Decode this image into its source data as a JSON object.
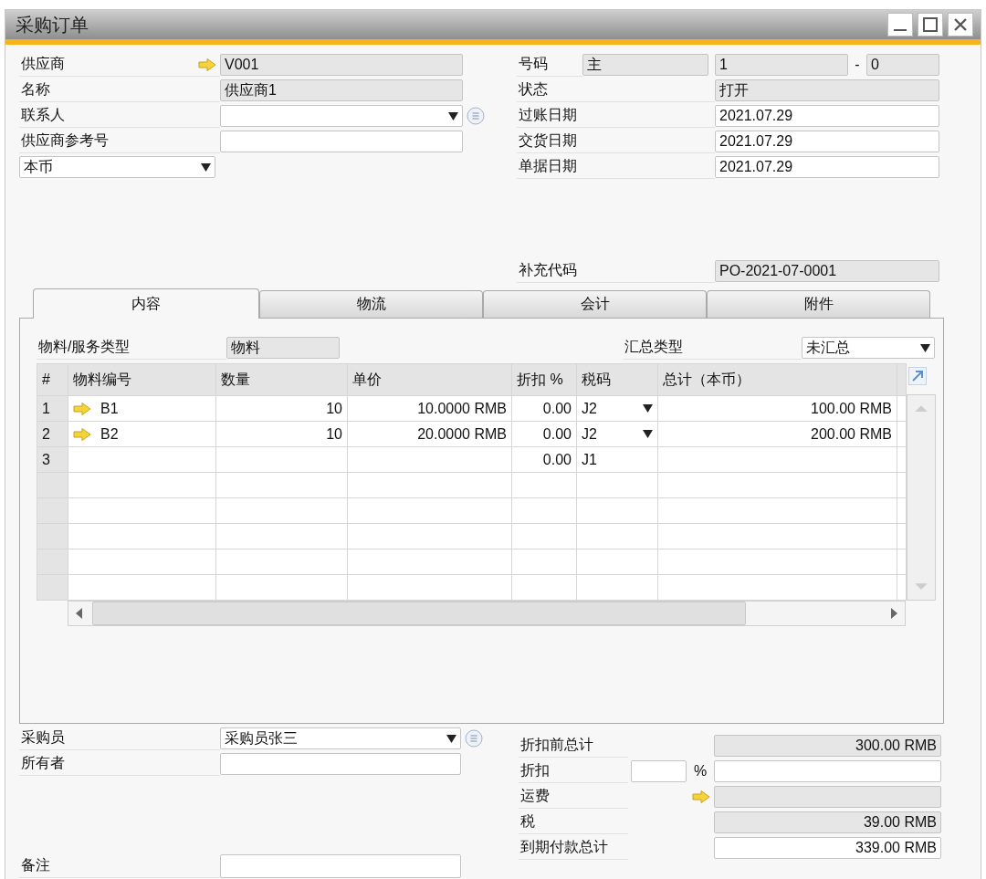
{
  "window": {
    "title": "采购订单"
  },
  "header_left": [
    {
      "label": "供应商",
      "value": "V001",
      "kind": "link",
      "readonly": true
    },
    {
      "label": "名称",
      "value": "供应商1",
      "kind": "text",
      "readonly": true
    },
    {
      "label": "联系人",
      "kind": "dropdown",
      "readonly": false
    },
    {
      "label": "供应商参考号",
      "kind": "text",
      "readonly": false
    }
  ],
  "currency": {
    "value": "本币"
  },
  "header_right": {
    "number": {
      "label": "号码",
      "series": "主",
      "value": "1",
      "separator": "-",
      "suffix": "0"
    },
    "fields": [
      {
        "label": "状态",
        "value": "打开",
        "readonly": true
      },
      {
        "label": "过账日期",
        "value": "2021.07.29",
        "readonly": false
      },
      {
        "label": "交货日期",
        "value": "2021.07.29",
        "readonly": false
      },
      {
        "label": "单据日期",
        "value": "2021.07.29",
        "readonly": false
      }
    ],
    "supplement": {
      "label": "补充代码",
      "value": "PO-2021-07-0001",
      "readonly": true
    }
  },
  "tabs": [
    {
      "label": "内容",
      "selected": true
    },
    {
      "label": "物流",
      "selected": false
    },
    {
      "label": "会计",
      "selected": false
    },
    {
      "label": "附件",
      "selected": false
    }
  ],
  "item_type": {
    "label": "物料/服务类型",
    "value": "物料"
  },
  "summary_type": {
    "label": "汇总类型",
    "value": "未汇总"
  },
  "table": {
    "columns": [
      "#",
      "物料编号",
      "数量",
      "单价",
      "折扣 %",
      "税码",
      "总计（本币）"
    ],
    "rows": [
      {
        "num": "1",
        "item": "B1",
        "link": true,
        "qty": "10",
        "price": "10.0000 RMB",
        "discount": "0.00",
        "tax_code": "J2",
        "tax_dropdown": true,
        "total": "100.00 RMB"
      },
      {
        "num": "2",
        "item": "B2",
        "link": true,
        "qty": "10",
        "price": "20.0000 RMB",
        "discount": "0.00",
        "tax_code": "J2",
        "tax_dropdown": true,
        "total": "200.00 RMB"
      },
      {
        "num": "3",
        "link": false,
        "discount": "0.00",
        "tax_code": "J1",
        "tax_dropdown": false
      }
    ]
  },
  "footer_left": [
    {
      "label": "采购员",
      "value": "采购员张三",
      "kind": "dropdown"
    },
    {
      "label": "所有者",
      "kind": "text"
    }
  ],
  "remarks": {
    "label": "备注"
  },
  "footer_right": [
    {
      "label": "折扣前总计",
      "value": "300.00 RMB",
      "kind": "text",
      "readonly": true
    },
    {
      "label": "折扣",
      "kind": "percent",
      "unit": "%",
      "readonly": false
    },
    {
      "label": "运费",
      "kind": "link",
      "readonly": true
    },
    {
      "label": "税",
      "value": "39.00 RMB",
      "kind": "text",
      "readonly": true
    },
    {
      "label": "到期付款总计",
      "value": "339.00 RMB",
      "kind": "text",
      "readonly": false
    }
  ]
}
